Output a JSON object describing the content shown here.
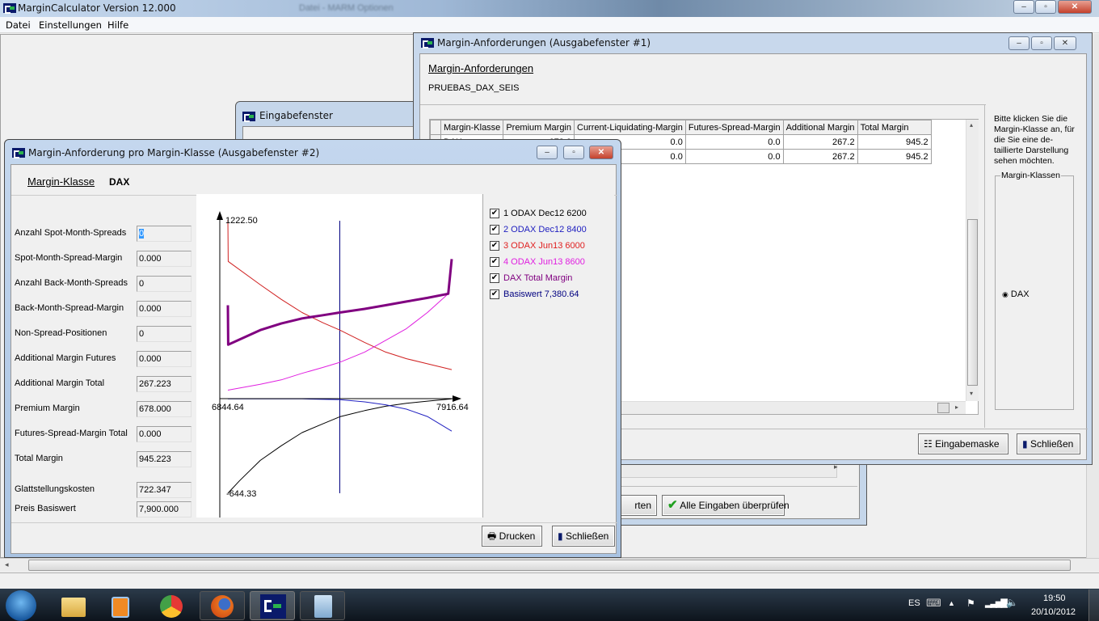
{
  "app": {
    "title": "MarginCalculator Version 12.000",
    "menu": [
      "Datei",
      "Einstellungen",
      "Hilfe"
    ],
    "bg_title": "Datei - MARM Optionen"
  },
  "win1": {
    "title": "Margin-Anforderungen (Ausgabefenster #1)",
    "heading": "Margin-Anforderungen",
    "portfolio": "PRUEBAS_DAX_SEIS",
    "table": {
      "columns": [
        "Margin-Klasse",
        "Premium Margin",
        "Current-Liquidating-Margin",
        "Futures-Spread-Margin",
        "Additional Margin",
        "Total Margin"
      ],
      "rows": [
        [
          "DAX",
          "678.0",
          "0.0",
          "0.0",
          "267.2",
          "945.2"
        ],
        [
          "",
          "",
          "0.0",
          "0.0",
          "267.2",
          "945.2"
        ]
      ]
    },
    "hint": "Bitte klicken Sie die Margin-Klasse an, für die Sie eine de-taillierte Darstellung sehen möchten.",
    "group_label": "Margin-Klassen",
    "radio_label": "DAX",
    "btn_input": "Eingabemaske",
    "btn_close": "Schließen"
  },
  "win_input": {
    "title": "Eingabefenster",
    "btn_partial": "rten",
    "btn_check": "Alle Eingaben überprüfen"
  },
  "win2": {
    "title": "Margin-Anforderung pro Margin-Klasse (Ausgabefenster #2)",
    "class_label": "Margin-Klasse",
    "class_value": "DAX",
    "fields": [
      {
        "label": "Anzahl Spot-Month-Spreads",
        "value": "0"
      },
      {
        "label": "Spot-Month-Spread-Margin",
        "value": "0.000"
      },
      {
        "label": "Anzahl Back-Month-Spreads",
        "value": "0"
      },
      {
        "label": "Back-Month-Spread-Margin",
        "value": "0.000"
      },
      {
        "label": "Non-Spread-Positionen",
        "value": "0"
      },
      {
        "label": "Additional Margin Futures",
        "value": "0.000"
      },
      {
        "label": "Additional Margin Total",
        "value": "267.223"
      },
      {
        "label": "Premium Margin",
        "value": "678.000"
      },
      {
        "label": "Futures-Spread-Margin Total",
        "value": "0.000"
      },
      {
        "label": "Total Margin",
        "value": "945.223"
      },
      {
        "label": "Glattstellungskosten",
        "value": "722.347"
      },
      {
        "label": "Preis Basiswert",
        "value": "7,900.000"
      }
    ],
    "btn_print": "Drucken",
    "btn_close": "Schließen"
  },
  "chart_data": {
    "type": "line",
    "title": "",
    "xlim": [
      6844.64,
      7916.64
    ],
    "ylim": [
      -644.33,
      1222.5
    ],
    "tick_labels": {
      "xmin": "6844.64",
      "xmax": "7916.64",
      "ymax": "1222.50",
      "ymin": "-644.33"
    },
    "vline": {
      "name": "Basiswert 7,380.64",
      "x": 7380.64,
      "color": "#000080"
    },
    "series": [
      {
        "name": "1 ODAX Dec12 6200",
        "color": "#000000",
        "width": 1,
        "points": [
          [
            6844.64,
            -644.33
          ],
          [
            6900,
            -560
          ],
          [
            7000,
            -420
          ],
          [
            7100,
            -320
          ],
          [
            7200,
            -230
          ],
          [
            7300,
            -170
          ],
          [
            7380.64,
            -122
          ],
          [
            7500,
            -80
          ],
          [
            7600,
            -50
          ],
          [
            7700,
            -30
          ],
          [
            7800,
            -15
          ],
          [
            7916.64,
            0
          ]
        ]
      },
      {
        "name": "2 ODAX Dec12 8400",
        "color": "#2020c0",
        "width": 1,
        "points": [
          [
            6844.64,
            0
          ],
          [
            7200,
            0
          ],
          [
            7380.64,
            -5
          ],
          [
            7500,
            -20
          ],
          [
            7600,
            -40
          ],
          [
            7700,
            -70
          ],
          [
            7800,
            -120
          ],
          [
            7916.64,
            -220
          ]
        ]
      },
      {
        "name": "3 ODAX Jun13 6000",
        "color": "#d02020",
        "width": 1,
        "points": [
          [
            6844.64,
            1222.5
          ],
          [
            6846,
            939
          ],
          [
            7000,
            780
          ],
          [
            7100,
            680
          ],
          [
            7200,
            590
          ],
          [
            7300,
            520
          ],
          [
            7380.64,
            470
          ],
          [
            7500,
            385
          ],
          [
            7600,
            320
          ],
          [
            7700,
            275
          ],
          [
            7800,
            240
          ],
          [
            7916.64,
            200
          ]
        ]
      },
      {
        "name": "4 ODAX Jun13 8600",
        "color": "#e020e0",
        "width": 1,
        "points": [
          [
            6844.64,
            60
          ],
          [
            7000,
            100
          ],
          [
            7100,
            130
          ],
          [
            7200,
            175
          ],
          [
            7300,
            215
          ],
          [
            7380.64,
            250
          ],
          [
            7500,
            320
          ],
          [
            7600,
            400
          ],
          [
            7700,
            480
          ],
          [
            7800,
            590
          ],
          [
            7900,
            718
          ]
        ]
      },
      {
        "name": "DAX Total Margin",
        "color": "#800080",
        "width": 3,
        "points": [
          [
            6844.64,
            640
          ],
          [
            6846,
            370
          ],
          [
            7000,
            470
          ],
          [
            7100,
            515
          ],
          [
            7200,
            550
          ],
          [
            7300,
            572
          ],
          [
            7380.64,
            590
          ],
          [
            7500,
            615
          ],
          [
            7600,
            640
          ],
          [
            7700,
            665
          ],
          [
            7800,
            690
          ],
          [
            7900,
            718
          ],
          [
            7916.64,
            955
          ]
        ]
      }
    ],
    "legend": [
      "1 ODAX Dec12 6200",
      "2 ODAX Dec12 8400",
      "3 ODAX Jun13 6000",
      "4 ODAX Jun13 8600",
      "DAX Total Margin",
      "Basiswert 7,380.64"
    ],
    "legend_colors": [
      "#000000",
      "#2020c0",
      "#e02020",
      "#e020e0",
      "#800080",
      "#000080"
    ],
    "legend_checked": [
      true,
      true,
      true,
      true,
      true,
      true
    ],
    "legend_placement": "right"
  },
  "taskbar": {
    "lang": "ES",
    "time": "19:50",
    "date": "20/10/2012",
    "icons": [
      "start-orb",
      "explorer",
      "media-player",
      "chrome",
      "firefox",
      "margincalculator",
      "calculator"
    ]
  }
}
